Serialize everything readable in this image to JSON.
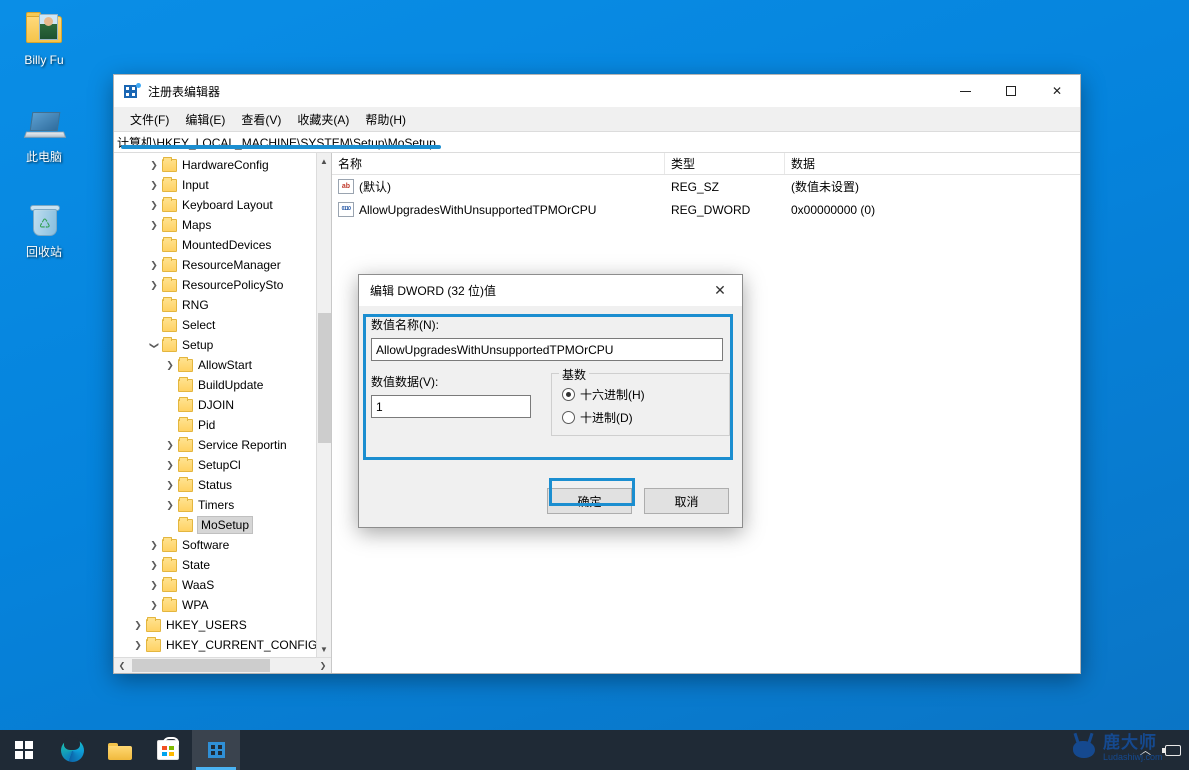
{
  "desktop": {
    "icons": [
      {
        "label": "Billy Fu",
        "icon": "user-folder-icon"
      },
      {
        "label": "此电脑",
        "icon": "this-pc-icon"
      },
      {
        "label": "回收站",
        "icon": "recycle-bin-icon"
      }
    ]
  },
  "regedit": {
    "title": "注册表编辑器",
    "menus": [
      "文件(F)",
      "编辑(E)",
      "查看(V)",
      "收藏夹(A)",
      "帮助(H)"
    ],
    "address": "计算机\\HKEY_LOCAL_MACHINE\\SYSTEM\\Setup\\MoSetup",
    "window_buttons": {
      "minimize": "minimize-button",
      "maximize": "maximize-button",
      "close": "close-button"
    },
    "tree": [
      {
        "label": "HardwareConfig",
        "indent": 2,
        "expander": "collapsed"
      },
      {
        "label": "Input",
        "indent": 2,
        "expander": "collapsed"
      },
      {
        "label": "Keyboard Layout",
        "indent": 2,
        "expander": "collapsed"
      },
      {
        "label": "Maps",
        "indent": 2,
        "expander": "collapsed"
      },
      {
        "label": "MountedDevices",
        "indent": 2,
        "expander": "none"
      },
      {
        "label": "ResourceManager",
        "indent": 2,
        "expander": "collapsed"
      },
      {
        "label": "ResourcePolicySto",
        "indent": 2,
        "expander": "collapsed"
      },
      {
        "label": "RNG",
        "indent": 2,
        "expander": "none"
      },
      {
        "label": "Select",
        "indent": 2,
        "expander": "none"
      },
      {
        "label": "Setup",
        "indent": 2,
        "expander": "expanded"
      },
      {
        "label": "AllowStart",
        "indent": 3,
        "expander": "collapsed"
      },
      {
        "label": "BuildUpdate",
        "indent": 3,
        "expander": "none"
      },
      {
        "label": "DJOIN",
        "indent": 3,
        "expander": "none"
      },
      {
        "label": "Pid",
        "indent": 3,
        "expander": "none"
      },
      {
        "label": "Service Reportin",
        "indent": 3,
        "expander": "collapsed"
      },
      {
        "label": "SetupCl",
        "indent": 3,
        "expander": "collapsed"
      },
      {
        "label": "Status",
        "indent": 3,
        "expander": "collapsed"
      },
      {
        "label": "Timers",
        "indent": 3,
        "expander": "collapsed"
      },
      {
        "label": "MoSetup",
        "indent": 3,
        "expander": "none",
        "selected": true
      },
      {
        "label": "Software",
        "indent": 2,
        "expander": "collapsed"
      },
      {
        "label": "State",
        "indent": 2,
        "expander": "collapsed"
      },
      {
        "label": "WaaS",
        "indent": 2,
        "expander": "collapsed"
      },
      {
        "label": "WPA",
        "indent": 2,
        "expander": "collapsed"
      },
      {
        "label": "HKEY_USERS",
        "indent": 1,
        "expander": "collapsed"
      },
      {
        "label": "HKEY_CURRENT_CONFIG",
        "indent": 1,
        "expander": "collapsed"
      }
    ],
    "columns": [
      "名称",
      "类型",
      "数据"
    ],
    "values": [
      {
        "name": "(默认)",
        "type": "REG_SZ",
        "data": "(数值未设置)",
        "icon": "reg-sz-icon"
      },
      {
        "name": "AllowUpgradesWithUnsupportedTPMOrCPU",
        "type": "REG_DWORD",
        "data": "0x00000000 (0)",
        "icon": "reg-dword-icon"
      }
    ]
  },
  "dialog": {
    "title": "编辑 DWORD (32 位)值",
    "close_label": "✕",
    "value_name_label": "数值名称(N):",
    "value_name": "AllowUpgradesWithUnsupportedTPMOrCPU",
    "value_data_label": "数值数据(V):",
    "value_data": "1",
    "base_legend": "基数",
    "base_options": [
      {
        "label": "十六进制(H)",
        "selected": true
      },
      {
        "label": "十进制(D)",
        "selected": false
      }
    ],
    "ok_label": "确定",
    "cancel_label": "取消"
  },
  "annotation": {
    "color": "#1b8ed0"
  },
  "taskbar": {
    "items": [
      {
        "name": "start-button",
        "icon": "windows-logo-icon"
      },
      {
        "name": "edge-button",
        "icon": "edge-icon"
      },
      {
        "name": "file-explorer-button",
        "icon": "folder-icon"
      },
      {
        "name": "microsoft-store-button",
        "icon": "store-icon"
      },
      {
        "name": "registry-editor-button",
        "icon": "regedit-icon",
        "active": true
      }
    ],
    "tray": {
      "chevron": "︿",
      "network": "network-icon"
    }
  },
  "watermark": {
    "cn": "鹿大师",
    "en": "Ludashiwj.com"
  }
}
